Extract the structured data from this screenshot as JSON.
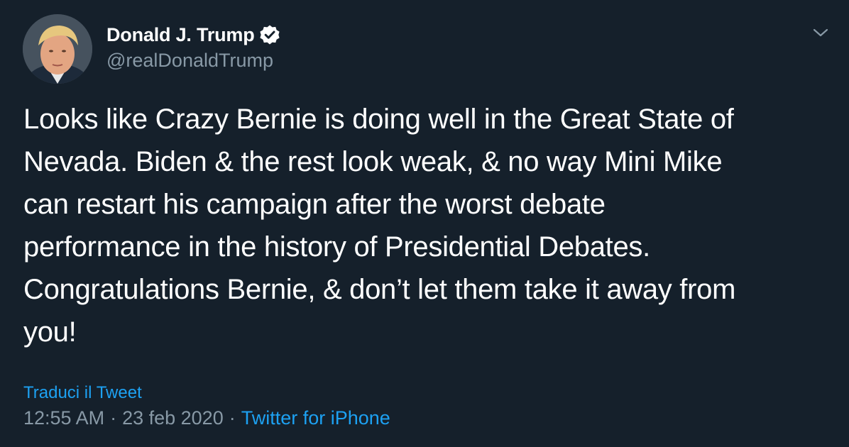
{
  "tweet": {
    "author": {
      "display_name": "Donald J. Trump",
      "handle": "@realDonaldTrump",
      "verified": true
    },
    "text": "Looks like Crazy Bernie is doing well in the Great State of\nNevada. Biden & the rest look weak, & no way Mini Mike\ncan restart his campaign after the worst debate\nperformance in the history of Presidential Debates.\nCongratulations Bernie, & don’t let them take it away from\nyou!",
    "translate_label": "Traduci il Tweet",
    "time": "12:55 AM",
    "separator": "·",
    "date": "23 feb 2020",
    "source": "Twitter for iPhone"
  },
  "icons": {
    "verified": "verified-badge-icon",
    "caret": "chevron-down-icon",
    "avatar": "profile-avatar"
  },
  "colors": {
    "background": "#15202b",
    "text": "#ffffff",
    "secondary_text": "#8899a6",
    "link": "#1da1f2"
  }
}
